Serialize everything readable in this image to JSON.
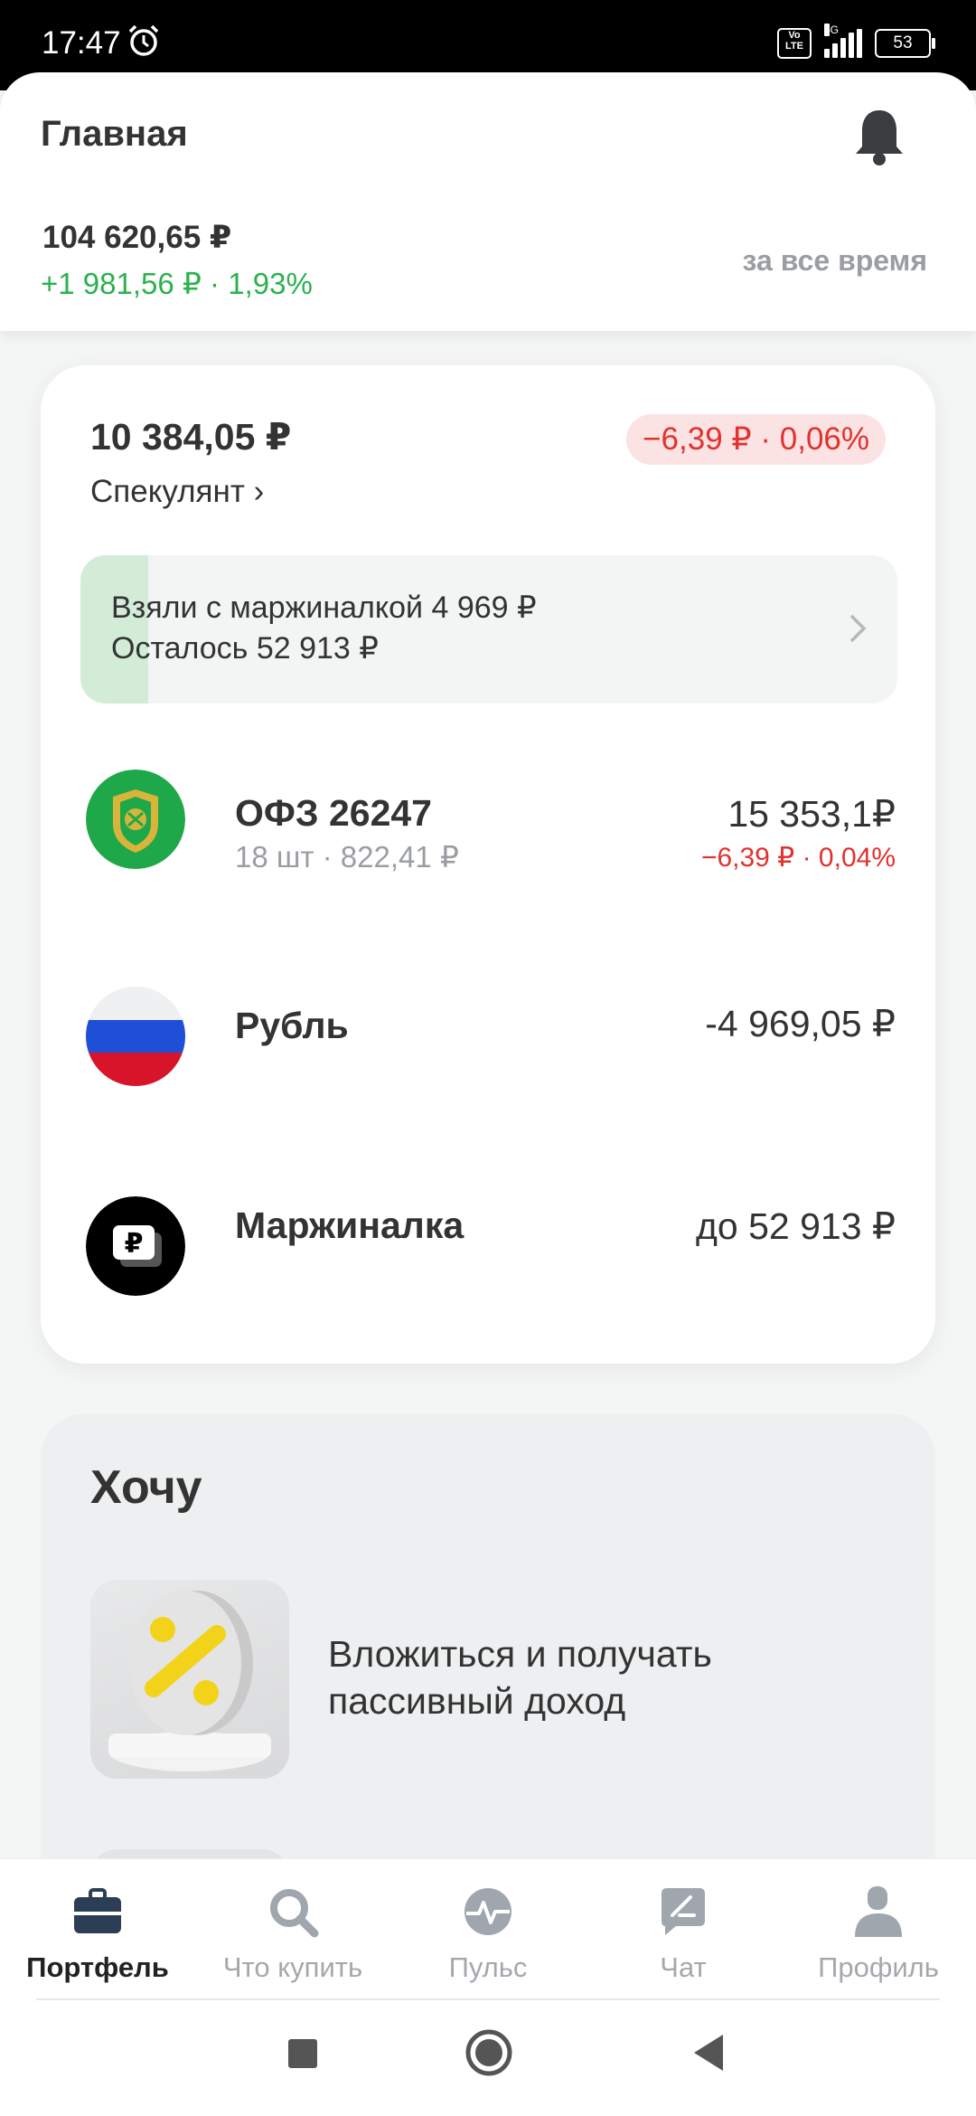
{
  "status_bar": {
    "time": "17:47",
    "network": "4G",
    "battery": "53",
    "volte": "Vo LTE"
  },
  "header": {
    "title": "Главная",
    "total_value": "104 620,65 ₽",
    "total_change": "+1 981,56 ₽ · 1,93%",
    "period": "за все время"
  },
  "account": {
    "value": "10 384,05 ₽",
    "change": "−6,39 ₽ · 0,06%",
    "name": "Спекулянт ›",
    "margin_banner": {
      "line1": "Взяли с маржиналкой 4 969 ₽",
      "line2": "Осталось 52 913 ₽"
    },
    "assets": [
      {
        "name": "ОФЗ 26247",
        "sub": "18 шт · 822,41 ₽",
        "amount": "15 353,1₽",
        "change": "−6,39 ₽ · 0,04%",
        "icon": "ofz-emblem-icon"
      },
      {
        "name": "Рубль",
        "sub": "",
        "amount": "-4 969,05 ₽",
        "change": "",
        "icon": "russia-flag-icon"
      },
      {
        "name": "Маржиналка",
        "sub": "",
        "amount": "до 52 913 ₽",
        "change": "",
        "icon": "margin-ruble-icon"
      }
    ]
  },
  "want": {
    "title": "Хочу",
    "items": [
      {
        "text": "Вложиться и получать пассивный доход",
        "icon": "percent-coin-icon"
      }
    ]
  },
  "bottom_nav": [
    {
      "label": "Портфель",
      "icon": "briefcase-icon",
      "active": true
    },
    {
      "label": "Что купить",
      "icon": "search-icon",
      "active": false
    },
    {
      "label": "Пульс",
      "icon": "pulse-icon",
      "active": false
    },
    {
      "label": "Чат",
      "icon": "chat-icon",
      "active": false
    },
    {
      "label": "Профиль",
      "icon": "profile-icon",
      "active": false
    }
  ],
  "colors": {
    "positive": "#2ab24e",
    "negative": "#e0322f",
    "negative_bg": "#fbe3e3",
    "margin_fill": "#d3ecd8"
  }
}
